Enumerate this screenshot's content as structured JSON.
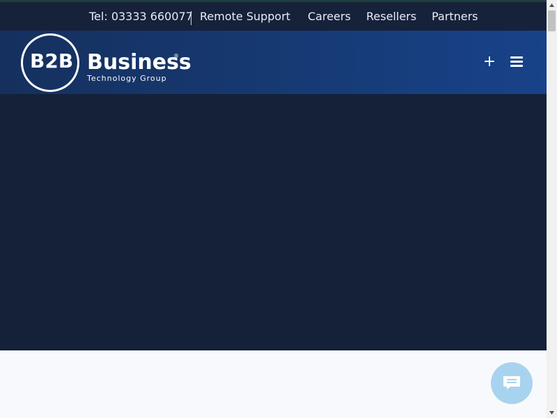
{
  "topbar": {
    "phone": "Tel: 03333 660077",
    "links": [
      "Remote Support",
      "Careers",
      "Resellers",
      "Partners"
    ]
  },
  "logo": {
    "mark": "B2B",
    "word": "Business",
    "reg": "®",
    "tagline": "Technology Group"
  },
  "header": {
    "plus_icon": "+",
    "menu_icon": "hamburger-icon"
  },
  "colors": {
    "topbar_bg": "#16213a",
    "header_gradient_start": "#15305e",
    "header_gradient_end": "#184289",
    "hero_bg": "#142139",
    "chat_button": "#a8d3ef"
  },
  "chat": {
    "icon": "chat-bubble-icon"
  }
}
